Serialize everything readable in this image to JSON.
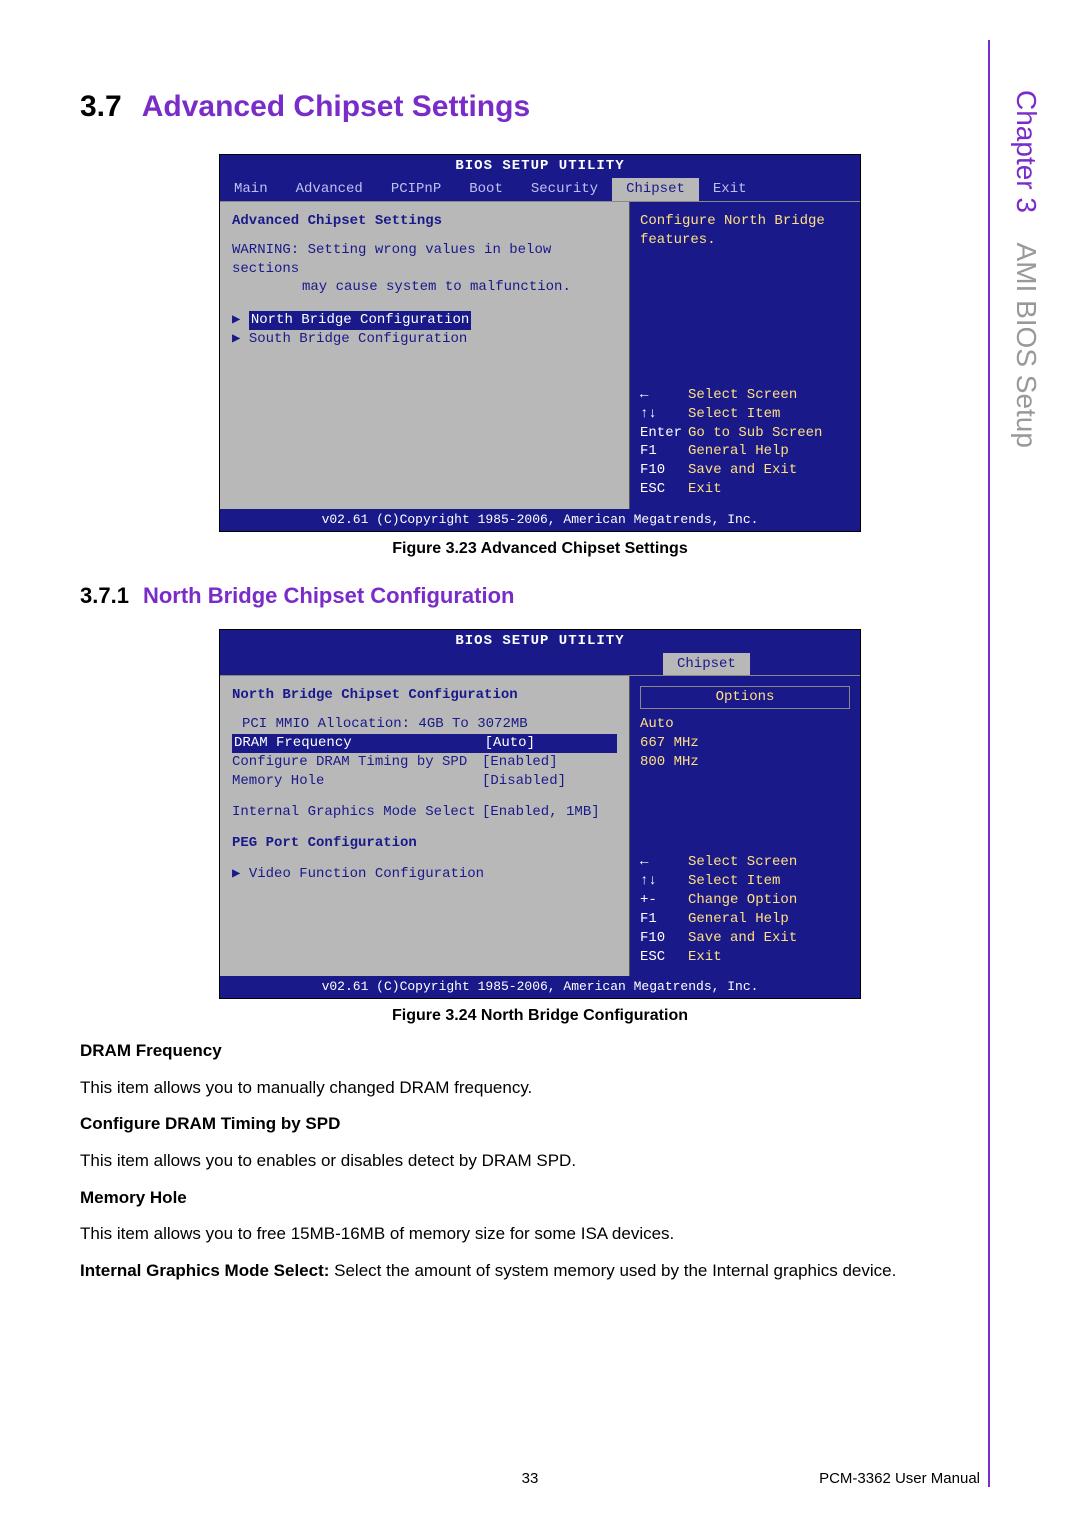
{
  "sidebar": {
    "chapter": "Chapter 3",
    "title": "AMI BIOS Setup"
  },
  "section": {
    "num": "3.7",
    "title": "Advanced Chipset Settings"
  },
  "fig1": {
    "bios_title": "BIOS SETUP UTILITY",
    "tabs": [
      "Main",
      "Advanced",
      "PCIPnP",
      "Boot",
      "Security",
      "Chipset",
      "Exit"
    ],
    "active_tab": "Chipset",
    "heading": "Advanced Chipset Settings",
    "warning1": "WARNING: Setting wrong values in below sections",
    "warning2": "may cause system to malfunction.",
    "item1": "North Bridge Configuration",
    "item2": "South Bridge Configuration",
    "right_desc1": "Configure North Bridge",
    "right_desc2": "features.",
    "help": [
      {
        "k": "←",
        "a": "Select Screen"
      },
      {
        "k": "↑↓",
        "a": "Select Item"
      },
      {
        "k": "Enter",
        "a": "Go to Sub Screen"
      },
      {
        "k": "F1",
        "a": "General Help"
      },
      {
        "k": "F10",
        "a": "Save and Exit"
      },
      {
        "k": "ESC",
        "a": "Exit"
      }
    ],
    "footer": "v02.61 (C)Copyright 1985-2006, American Megatrends, Inc.",
    "caption": "Figure 3.23 Advanced Chipset Settings"
  },
  "subsection": {
    "num": "3.7.1",
    "title": "North Bridge Chipset Configuration"
  },
  "fig2": {
    "bios_title": "BIOS SETUP UTILITY",
    "active_tab": "Chipset",
    "heading": "North Bridge Chipset Configuration",
    "line_alloc": "PCI MMIO Allocation: 4GB To 3072MB",
    "row1": {
      "lbl": "DRAM Frequency",
      "val": "[Auto]"
    },
    "row2": {
      "lbl": "Configure DRAM Timing by SPD",
      "val": "[Enabled]"
    },
    "row3": {
      "lbl": "Memory Hole",
      "val": "[Disabled]"
    },
    "row4": {
      "lbl": "Internal Graphics Mode Select",
      "val": "[Enabled, 1MB]"
    },
    "peg": "PEG Port Configuration",
    "video": "Video Function Configuration",
    "options_hdr": "Options",
    "options": [
      "Auto",
      "667 MHz",
      "800 MHz"
    ],
    "help": [
      {
        "k": "←",
        "a": "Select Screen"
      },
      {
        "k": "↑↓",
        "a": "Select Item"
      },
      {
        "k": "+-",
        "a": "Change Option"
      },
      {
        "k": "F1",
        "a": "General Help"
      },
      {
        "k": "F10",
        "a": "Save and Exit"
      },
      {
        "k": "ESC",
        "a": "Exit"
      }
    ],
    "footer": "v02.61 (C)Copyright 1985-2006, American Megatrends, Inc.",
    "caption": "Figure 3.24 North Bridge Configuration"
  },
  "body": {
    "h1": "DRAM Frequency",
    "p1": "This item allows you to manually changed DRAM frequency.",
    "h2": "Configure DRAM Timing by SPD",
    "p2": "This item allows you to enables or disables detect by DRAM SPD.",
    "h3": "Memory Hole",
    "p3": "This item allows you to free 15MB-16MB of memory size for some ISA devices.",
    "h4a": "Internal Graphics Mode Select: ",
    "h4b": "Select the amount of system memory used by the Internal graphics device."
  },
  "footer": {
    "page": "33",
    "doc": "PCM-3362 User Manual"
  }
}
